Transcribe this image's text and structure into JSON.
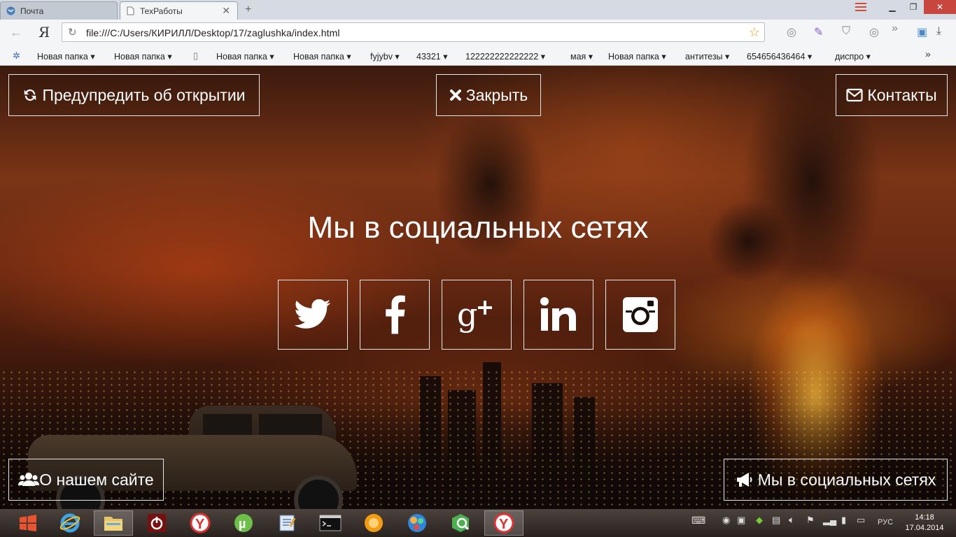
{
  "browser": {
    "tabs": [
      {
        "label": "Почта",
        "icon": "yandex-mail-icon",
        "active": false
      },
      {
        "label": "ТехРаботы",
        "icon": "page-icon",
        "active": true
      }
    ],
    "new_tab": "+",
    "yandex_button": "Я",
    "address": "file:///C:/Users/КИРИЛЛ/Desktop/17/zaglushka/index.html",
    "bookmarks": [
      {
        "label": "Новая папка ▾"
      },
      {
        "label": "Новая папка ▾"
      },
      {
        "label": "Новая папка ▾"
      },
      {
        "label": "Новая папка ▾"
      },
      {
        "label": "fyjybv ▾"
      },
      {
        "label": "43321 ▾"
      },
      {
        "label": "122222222222222 ▾"
      },
      {
        "label": "мая ▾"
      },
      {
        "label": "Новая папка ▾"
      },
      {
        "label": "антитезы ▾"
      },
      {
        "label": "654656436464 ▾"
      },
      {
        "label": "диспро ▾"
      }
    ],
    "bookmarks_more": "»"
  },
  "page": {
    "notify_button": "Предупредить об открытии",
    "close_button": "Закрыть",
    "contacts_button": "Контакты",
    "heading": "Мы в социальных сетях",
    "social": [
      {
        "name": "twitter",
        "icon": "twitter-icon"
      },
      {
        "name": "facebook",
        "icon": "facebook-icon"
      },
      {
        "name": "google-plus",
        "icon": "google-plus-icon"
      },
      {
        "name": "linkedin",
        "icon": "linkedin-icon"
      },
      {
        "name": "instagram",
        "icon": "instagram-icon"
      }
    ],
    "about_button": "О нашем сайте",
    "social_button": "Мы в социальных сетях"
  },
  "taskbar": {
    "language": "РУС",
    "time": "14:18",
    "date": "17.04.2014"
  },
  "colors": {
    "accent_red": "#c7463d",
    "button_border": "#e8e8e8"
  }
}
